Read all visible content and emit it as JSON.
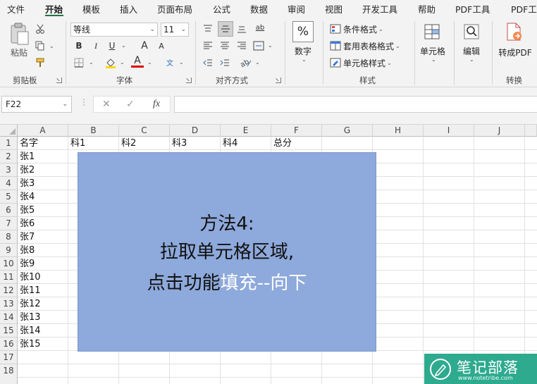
{
  "menu": {
    "tabs": [
      {
        "label": "文件"
      },
      {
        "label": "开始"
      },
      {
        "label": "模板"
      },
      {
        "label": "插入"
      },
      {
        "label": "页面布局"
      },
      {
        "label": "公式"
      },
      {
        "label": "数据"
      },
      {
        "label": "审阅"
      },
      {
        "label": "视图"
      },
      {
        "label": "开发工具"
      },
      {
        "label": "帮助"
      },
      {
        "label": "PDF工具"
      },
      {
        "label": "PDF工"
      }
    ],
    "active_tab": "开始"
  },
  "ribbon": {
    "clipboard": {
      "paste_label": "粘贴",
      "group_label": "剪贴板"
    },
    "font": {
      "font_name": "等线",
      "font_size": "11",
      "bold": "B",
      "italic": "I",
      "underline": "U",
      "grow_font": "A",
      "shrink_font": "A",
      "font_color_glyph": "A",
      "phonetic_glyph": "文",
      "group_label": "字体"
    },
    "alignment": {
      "wrap_glyph": "ab",
      "group_label": "对齐方式"
    },
    "number": {
      "symbol": "%",
      "label": "数字"
    },
    "styles": {
      "conditional": "条件格式",
      "table_format": "套用表格格式",
      "cell_styles": "单元格样式",
      "group_label": "样式"
    },
    "cells": {
      "label": "单元格"
    },
    "editing": {
      "label": "编辑"
    },
    "convert": {
      "button_label": "转成PDF",
      "group_label": "转换"
    }
  },
  "formula_bar": {
    "name_box": "F22",
    "fx_label": "fx",
    "formula": ""
  },
  "sheet": {
    "columns": [
      "A",
      "B",
      "C",
      "D",
      "E",
      "F",
      "G",
      "H",
      "I",
      "J"
    ],
    "rows": [
      "1",
      "2",
      "3",
      "4",
      "5",
      "6",
      "7",
      "8",
      "9",
      "10",
      "11",
      "12",
      "13",
      "14",
      "15",
      "16",
      "17",
      "18"
    ],
    "header_row": [
      "名字",
      "科1",
      "科2",
      "科3",
      "科4",
      "总分"
    ],
    "names": [
      "张1",
      "张2",
      "张3",
      "张4",
      "张5",
      "张6",
      "张7",
      "张8",
      "张9",
      "张10",
      "张11",
      "张12",
      "张13",
      "张14",
      "张15"
    ]
  },
  "overlay": {
    "line1": "方法4:",
    "line2": "拉取单元格区域,",
    "line3_prefix": "点击功能",
    "line3_highlight": "填充--向下",
    "bg_color": "#8ea9db",
    "highlight_color": "#ffffff"
  },
  "watermark": {
    "title": "笔记部落",
    "url": "www.notetribe.com",
    "color": "#2eaa8e"
  }
}
